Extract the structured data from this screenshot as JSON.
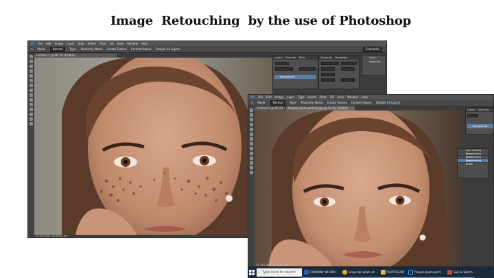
{
  "headline": "Image  Retouching  by the use of Photoshop",
  "photoshop": {
    "menu": [
      "Ps",
      "File",
      "Edit",
      "Image",
      "Layer",
      "Type",
      "Select",
      "Filter",
      "3D",
      "View",
      "Window",
      "Help"
    ],
    "options": {
      "mode_label": "Mode:",
      "mode_value": "Normal",
      "type_label": "Type:",
      "proximity": "Proximity Match",
      "texture": "Create Texture",
      "content": "Content-Aware",
      "sample": "Sample All Layers"
    },
    "workspace": "Essentials",
    "doc_tab_before": "Untitled-1 @ 66.7% (RGB/8)",
    "doc_tab_after": "Untitled-1 @ 66.7% (RGB/8)",
    "doc_tab_active": "freepik-photo-portrait.jpg @ 33.3% (RGB/8)",
    "status_before": "33.33%   Doc: 16.2M/31.6M",
    "status_after": "33.33%   Doc: 16.2M/31.6M",
    "panels": {
      "layers_tabs": [
        "Layers",
        "Channels",
        "Paths"
      ],
      "character_tabs": [
        "Character",
        "Paragraph"
      ],
      "font": "Tahoma",
      "style": "Regular",
      "size": "11 pt",
      "leading": "(Auto)",
      "kind": "Kind",
      "blend": "Normal",
      "opacity": "100%",
      "fill": "100%",
      "layer_name": "Background",
      "right_panel": [
        "Color",
        "Swatches"
      ]
    },
    "healing_menu": [
      "Spot Healing Brush",
      "Spot Healing Brush",
      "Spot Healing Brush",
      "Spot Healing Brush"
    ]
  },
  "taskbar": {
    "search_placeholder": "Type here to search",
    "items": [
      "COMPANY INFORM...",
      "Grayscale photo of...",
      "PHOTOSHOP",
      "freepik-photo-portr...",
      "Snip & Sketch"
    ],
    "colors": {
      "taskbar": "#1b2a3a",
      "word": "#2b5fb4",
      "chrome": "#f2b01e",
      "folder": "#e8b44a",
      "photoshop": "#2d9ff2",
      "snip": "#c54a2a"
    }
  }
}
